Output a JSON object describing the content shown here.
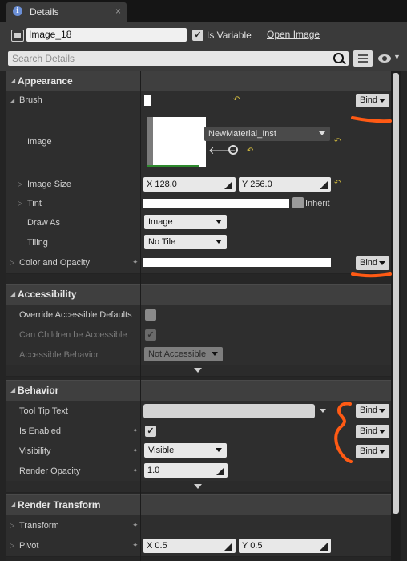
{
  "tab": {
    "title": "Details",
    "icon": "info-icon",
    "close": "×"
  },
  "header": {
    "name_value": "Image_18",
    "is_variable_label": "Is Variable",
    "is_variable_checked": true,
    "open_link": "Open Image",
    "search_placeholder": "Search Details"
  },
  "appearance": {
    "title": "Appearance",
    "brush_label": "Brush",
    "image_label": "Image",
    "material_name": "NewMaterial_Inst",
    "image_size_label": "Image Size",
    "size_x": "X  128.0",
    "size_y": "Y  256.0",
    "tint_label": "Tint",
    "inherit_label": "Inherit",
    "draw_as_label": "Draw As",
    "draw_as_value": "Image",
    "tiling_label": "Tiling",
    "tiling_value": "No Tile",
    "color_opacity_label": "Color and Opacity"
  },
  "accessibility": {
    "title": "Accessibility",
    "override_label": "Override Accessible Defaults",
    "children_label": "Can Children be Accessible",
    "behavior_label": "Accessible Behavior",
    "behavior_value": "Not Accessible"
  },
  "behavior": {
    "title": "Behavior",
    "tooltip_label": "Tool Tip Text",
    "enabled_label": "Is Enabled",
    "visibility_label": "Visibility",
    "visibility_value": "Visible",
    "opacity_label": "Render Opacity",
    "opacity_value": "1.0"
  },
  "render_transform": {
    "title": "Render Transform",
    "transform_label": "Transform",
    "pivot_label": "Pivot",
    "pivot_x": "X  0.5",
    "pivot_y": "Y  0.5"
  },
  "bind_label": "Bind",
  "annotation_color": "#ff5a14",
  "accent_color": "#d8c040"
}
